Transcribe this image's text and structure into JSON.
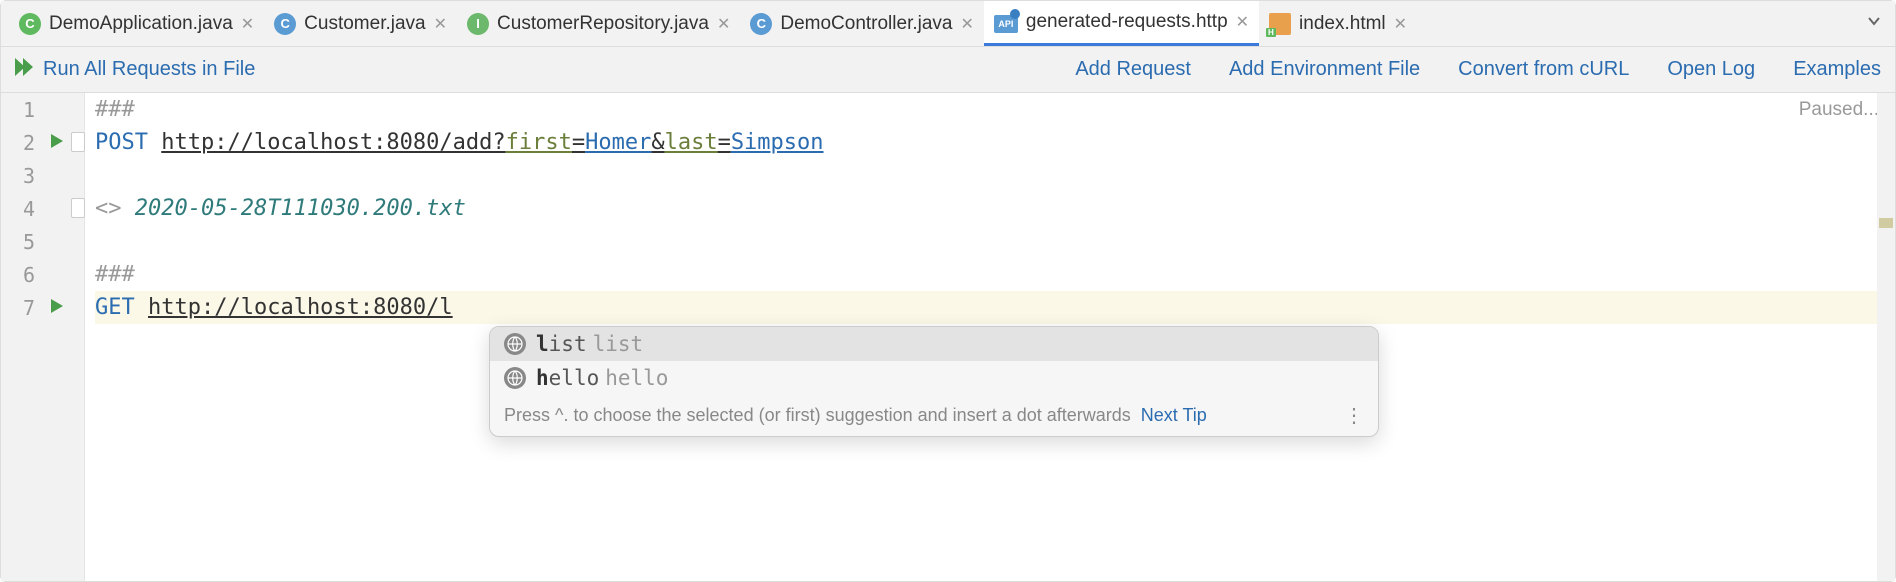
{
  "tabs": [
    {
      "label": "DemoApplication.java",
      "iconType": "c-green",
      "iconText": "C"
    },
    {
      "label": "Customer.java",
      "iconType": "c-blue",
      "iconText": "C"
    },
    {
      "label": "CustomerRepository.java",
      "iconType": "i-green",
      "iconText": "I"
    },
    {
      "label": "DemoController.java",
      "iconType": "c-blue",
      "iconText": "C"
    },
    {
      "label": "generated-requests.http",
      "iconType": "api",
      "iconText": "API",
      "active": true
    },
    {
      "label": "index.html",
      "iconType": "html",
      "iconText": "H"
    }
  ],
  "toolbar": {
    "runAll": "Run All Requests in File",
    "links": [
      "Add Request",
      "Add Environment File",
      "Convert from cURL",
      "Open Log",
      "Examples"
    ]
  },
  "editor": {
    "status": "Paused...",
    "lines": {
      "l1_comment": "###",
      "l2_method": "POST",
      "l2_url": "http://localhost:8080/add?",
      "l2_p1": "first",
      "l2_v1": "Homer",
      "l2_amp": "&",
      "l2_p2": "last",
      "l2_v2": "Simpson",
      "l4_open": "<> ",
      "l4_file": "2020-05-28T111030.200.txt",
      "l6_comment": "###",
      "l7_method": "GET",
      "l7_url": "http://localhost:8080/l"
    }
  },
  "gutter": {
    "nums": [
      "1",
      "2",
      "3",
      "4",
      "5",
      "6",
      "7"
    ]
  },
  "autocomplete": {
    "items": [
      {
        "bold": "l",
        "rest": "ist",
        "hint": "list"
      },
      {
        "bold": "h",
        "rest": "ello",
        "hint": "hello"
      }
    ],
    "footer": "Press ^. to choose the selected (or first) suggestion and insert a dot afterwards",
    "nextTip": "Next Tip"
  }
}
